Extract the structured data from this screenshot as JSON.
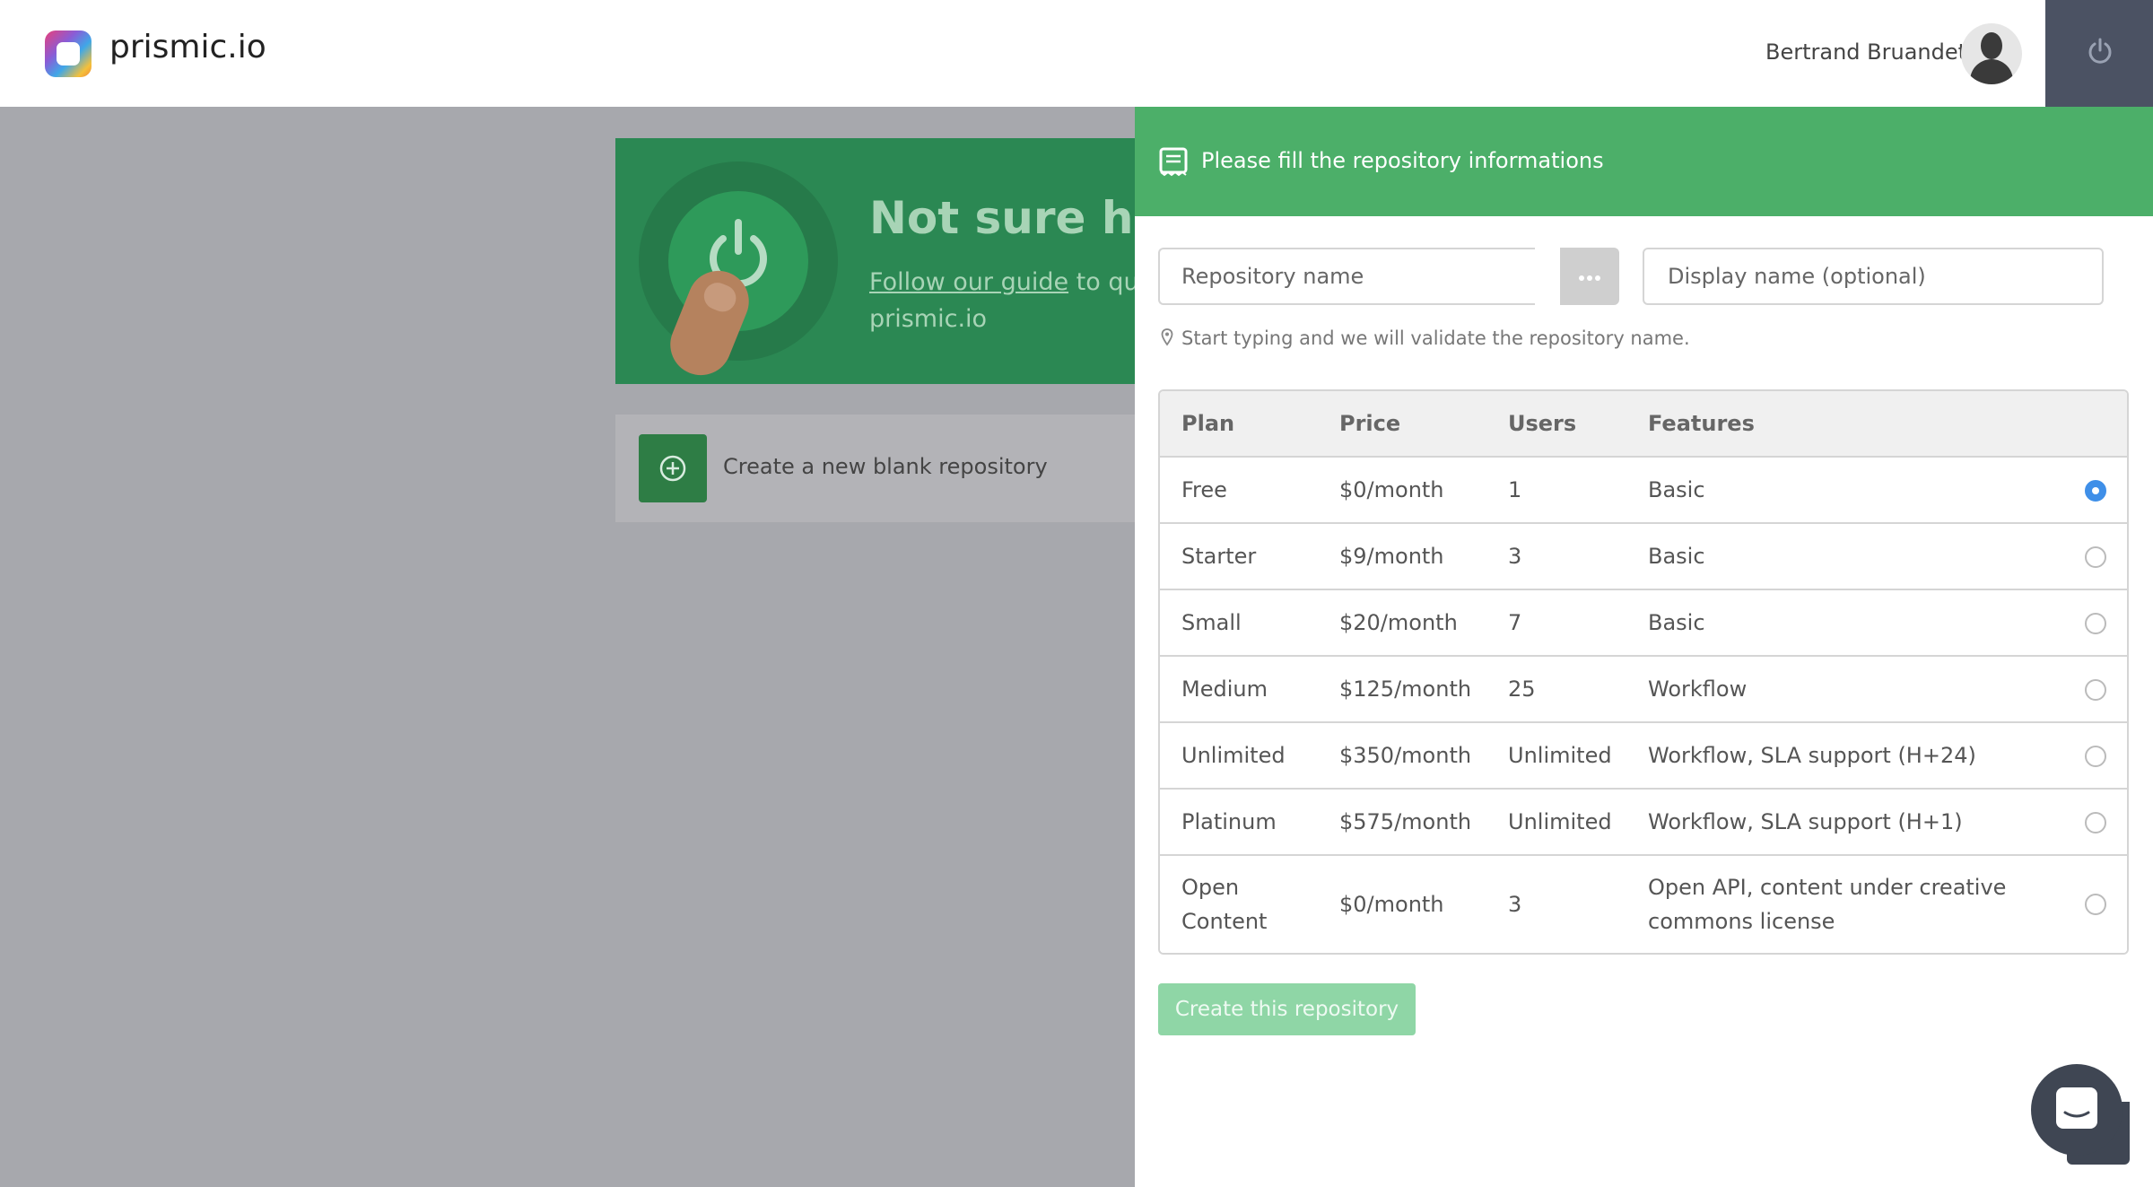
{
  "header": {
    "brand": "prismic.io",
    "user_name": "Bertrand Bruandet"
  },
  "background": {
    "guide_title": "Not sure how",
    "guide_link": "Follow our guide",
    "guide_rest": " to quic",
    "guide_line2": "prismic.io",
    "blank_repo_label": "Create a new blank repository"
  },
  "panel": {
    "title": "Please fill the repository informations",
    "repo_name_placeholder": "Repository name",
    "display_name_placeholder": "Display name (optional)",
    "hint": "Start typing and we will validate the repository name.",
    "table": {
      "headers": {
        "plan": "Plan",
        "price": "Price",
        "users": "Users",
        "features": "Features"
      },
      "rows": [
        {
          "plan": "Free",
          "price": "$0/month",
          "users": "1",
          "features": "Basic",
          "selected": true
        },
        {
          "plan": "Starter",
          "price": "$9/month",
          "users": "3",
          "features": "Basic",
          "selected": false
        },
        {
          "plan": "Small",
          "price": "$20/month",
          "users": "7",
          "features": "Basic",
          "selected": false
        },
        {
          "plan": "Medium",
          "price": "$125/month",
          "users": "25",
          "features": "Workflow",
          "selected": false
        },
        {
          "plan": "Unlimited",
          "price": "$350/month",
          "users": "Unlimited",
          "features": "Workflow, SLA support (H+24)",
          "selected": false
        },
        {
          "plan": "Platinum",
          "price": "$575/month",
          "users": "Unlimited",
          "features": "Workflow, SLA support (H+1)",
          "selected": false
        },
        {
          "plan": "Open Content",
          "price": "$0/month",
          "users": "3",
          "features": "Open API, content under creative commons license",
          "selected": false
        }
      ]
    },
    "create_button": "Create this repository"
  },
  "colors": {
    "header_bg": "#ffffff",
    "power_bg": "#4b5263",
    "panel_header": "#4caf69",
    "guide_card": "#2b8853",
    "create_button": "#8fd6a6",
    "radio_selected": "#3f8fe8",
    "chat_bubble": "#3f4653"
  },
  "icons": [
    "prismic-logo-icon",
    "avatar-icon",
    "power-icon",
    "power-disc-icon",
    "add-circle-icon",
    "document-icon",
    "map-marker-icon",
    "ellipsis-icon",
    "chat-icon"
  ]
}
